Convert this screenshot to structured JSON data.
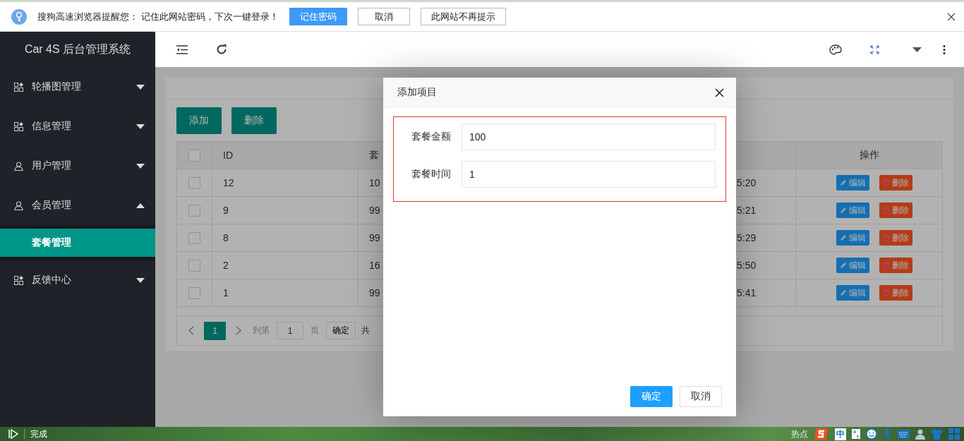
{
  "browser_prompt": {
    "message": "搜狗高速浏览器提醒您： 记住此网站密码，下次一键登录！",
    "buttons": [
      {
        "label": "记住密码",
        "primary": true
      },
      {
        "label": "取消",
        "primary": false
      },
      {
        "label": "此网站不再提示",
        "primary": false
      }
    ]
  },
  "sidebar": {
    "title": "Car 4S 后台管理系统",
    "items": [
      {
        "label": "轮播图管理",
        "kind": "grid",
        "expanded": false
      },
      {
        "label": "信息管理",
        "kind": "grid",
        "expanded": false
      },
      {
        "label": "用户管理",
        "kind": "user",
        "expanded": false
      },
      {
        "label": "会员管理",
        "kind": "user",
        "expanded": true,
        "children": [
          {
            "label": "套餐管理",
            "selected": true
          }
        ]
      },
      {
        "label": "反馈中心",
        "kind": "grid",
        "expanded": false
      }
    ]
  },
  "actions": [
    "添加",
    "删除"
  ],
  "table": {
    "all_checked": false,
    "columns": [
      "ID",
      "套",
      "操作"
    ],
    "rows": [
      {
        "checked": false,
        "id": "12",
        "column_3": "10",
        "column_5": "5:20",
        "buttons": [
          "编辑",
          "删除"
        ]
      },
      {
        "checked": false,
        "id": "9",
        "column_3": "99",
        "column_5": "5:21",
        "buttons": [
          "编辑",
          "删除"
        ]
      },
      {
        "checked": false,
        "id": "8",
        "column_3": "99",
        "column_5": "5:29",
        "buttons": [
          "编辑",
          "删除"
        ]
      },
      {
        "checked": false,
        "id": "2",
        "column_3": "16",
        "column_5": "5:50",
        "buttons": [
          "编辑",
          "删除"
        ]
      },
      {
        "checked": false,
        "id": "1",
        "column_3": "99",
        "column_5": "5:41",
        "buttons": [
          "编辑",
          "删除"
        ]
      }
    ]
  },
  "pagination": {
    "current": "1",
    "goto_label": "到第",
    "page_input": "1",
    "page_unit": "页",
    "confirm": "确定",
    "total": "共"
  },
  "dialog": {
    "title": "添加项目",
    "fields": [
      {
        "label": "套餐金额",
        "value": "100"
      },
      {
        "label": "套餐时间",
        "value": "1"
      }
    ],
    "buttons": [
      {
        "label": "确定",
        "primary": true
      },
      {
        "label": "取消",
        "primary": false
      }
    ]
  },
  "status_bar": {
    "text": "完成"
  },
  "ime_toolbar": {
    "hotspot": "热点",
    "mode": "中",
    "punctuation": "°,"
  }
}
